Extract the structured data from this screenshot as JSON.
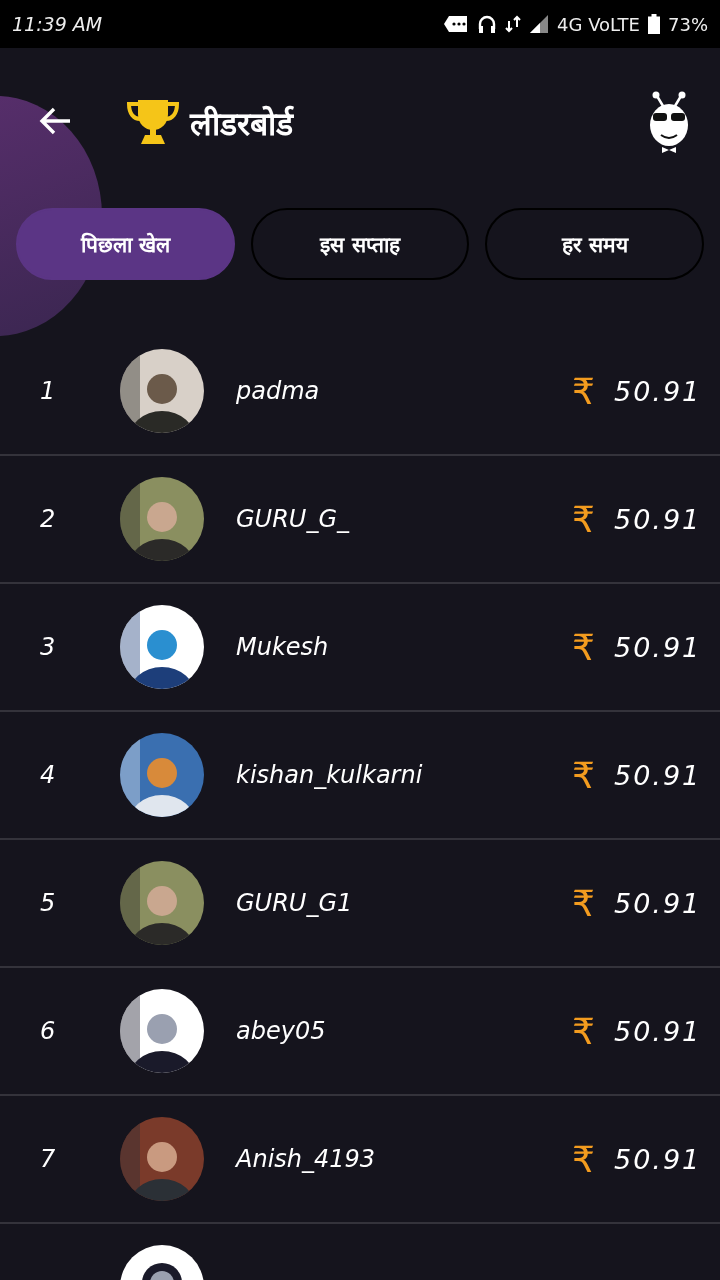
{
  "status_bar": {
    "time": "11:39 AM",
    "network": "4G VoLTE",
    "battery": "73%"
  },
  "header": {
    "title": "लीडरबोर्ड"
  },
  "tabs": [
    {
      "label": "पिछला खेल",
      "selected": true
    },
    {
      "label": "इस सप्ताह",
      "selected": false
    },
    {
      "label": "हर समय",
      "selected": false
    }
  ],
  "rows": [
    {
      "rank": "1",
      "name": "padma",
      "currency": "₹",
      "amount": "50.91"
    },
    {
      "rank": "2",
      "name": "GURU_G_",
      "currency": "₹",
      "amount": "50.91"
    },
    {
      "rank": "3",
      "name": "Mukesh",
      "currency": "₹",
      "amount": "50.91"
    },
    {
      "rank": "4",
      "name": "kishan_kulkarni",
      "currency": "₹",
      "amount": "50.91"
    },
    {
      "rank": "5",
      "name": "GURU_G1",
      "currency": "₹",
      "amount": "50.91"
    },
    {
      "rank": "6",
      "name": "abey05",
      "currency": "₹",
      "amount": "50.91"
    },
    {
      "rank": "7",
      "name": "Anish_4193",
      "currency": "₹",
      "amount": "50.91"
    }
  ]
}
